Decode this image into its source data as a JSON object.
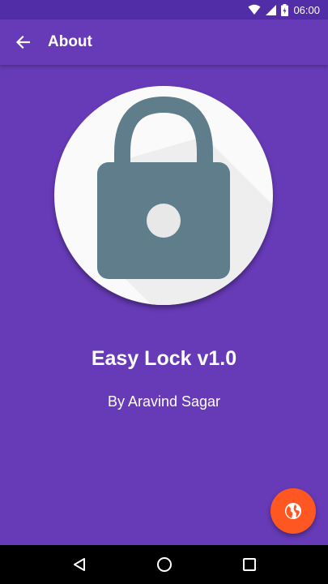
{
  "status_bar": {
    "time": "06:00",
    "icons": [
      "wifi-icon",
      "cell-signal-icon",
      "battery-icon"
    ]
  },
  "app_bar": {
    "title": "About",
    "back_icon": "arrow-back-icon"
  },
  "about": {
    "logo_icon": "lock-icon",
    "app_name": "Easy Lock v1.0",
    "author": "By Aravind Sagar"
  },
  "fab": {
    "icon": "globe-icon",
    "color": "#ff5722"
  },
  "nav_bar": {
    "icons": [
      "back-triangle-icon",
      "home-circle-icon",
      "recents-square-icon"
    ]
  },
  "colors": {
    "primary": "#673ab7",
    "primary_dark": "#512da8",
    "accent": "#ff5722",
    "lock": "#607d8b"
  }
}
